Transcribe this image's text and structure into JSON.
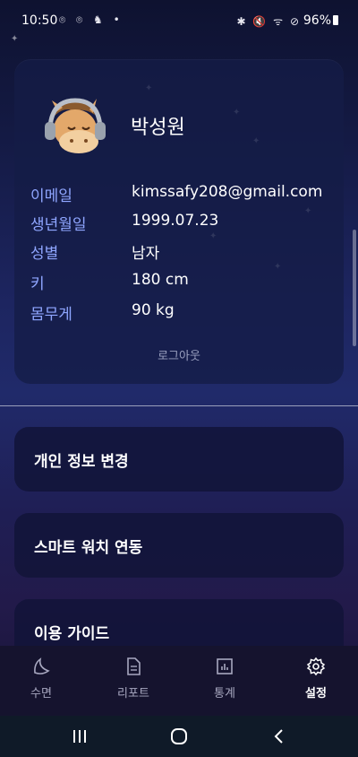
{
  "status_bar": {
    "time": "10:50",
    "left_icons": "⌾ ⌾ ♞ •",
    "right_icons": "✱ 🔇 ᯤ ⊘",
    "battery": "96%"
  },
  "profile": {
    "name": "박성원",
    "avatar": "horse-with-headphones-avatar",
    "fields": [
      {
        "label": "이메일",
        "value": "kimssafy208@gmail.com"
      },
      {
        "label": "생년월일",
        "value": "1999.07.23"
      },
      {
        "label": "성별",
        "value": "남자"
      },
      {
        "label": "키",
        "value": "180 cm"
      },
      {
        "label": "몸무게",
        "value": "90 kg"
      }
    ],
    "logout_label": "로그아웃"
  },
  "menu": {
    "items": [
      {
        "label": "개인 정보 변경"
      },
      {
        "label": "스마트 워치 연동"
      },
      {
        "label": "이용 가이드"
      }
    ]
  },
  "bottom_nav": {
    "items": [
      {
        "label": "수면",
        "icon": "moon-icon"
      },
      {
        "label": "리포트",
        "icon": "document-icon"
      },
      {
        "label": "통계",
        "icon": "bar-chart-icon"
      },
      {
        "label": "설정",
        "icon": "gear-icon",
        "active": true
      }
    ]
  },
  "colors": {
    "label_accent": "#8fa6ff",
    "card_bg": "#151c46",
    "nav_bg": "#15132e"
  }
}
